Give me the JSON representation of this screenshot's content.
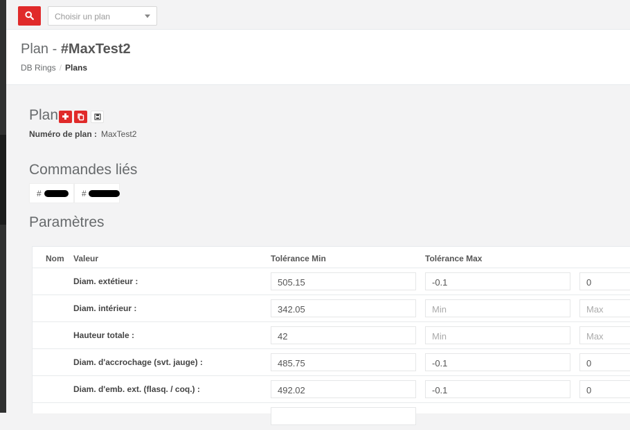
{
  "toolbar": {
    "select_placeholder": "Choisir un plan"
  },
  "header": {
    "title_prefix": "Plan - ",
    "title_id": "#MaxTest2",
    "breadcrumb": [
      "DB Rings",
      "Plans"
    ],
    "breadcrumb_sep": "/"
  },
  "plan_section": {
    "title": "Plan",
    "number_label": "Numéro de plan :",
    "number_value": "MaxTest2"
  },
  "orders_section": {
    "title": "Commandes liés",
    "items": [
      {
        "hash": "#",
        "redacted": true
      },
      {
        "hash": "#",
        "redacted": true
      }
    ]
  },
  "params_section": {
    "title": "Paramètres",
    "columns": [
      "Nom",
      "Valeur",
      "Tolérance Min",
      "Tolérance Max"
    ],
    "rows": [
      {
        "label": "Diam. extétieur :",
        "value": "505.15",
        "tol_min": "-0.1",
        "tol_max": "0"
      },
      {
        "label": "Diam. intérieur :",
        "value": "342.05",
        "tol_min": "",
        "tol_max": ""
      },
      {
        "label": "Hauteur totale :",
        "value": "42",
        "tol_min": "",
        "tol_max": ""
      },
      {
        "label": "Diam. d'accrochage (svt. jauge) :",
        "value": "485.75",
        "tol_min": "-0.1",
        "tol_max": "0"
      },
      {
        "label": "Diam. d'emb. ext. (flasq. / coq.) :",
        "value": "492.02",
        "tol_min": "-0.1",
        "tol_max": "0"
      }
    ],
    "placeholder_min": "Min",
    "placeholder_max": "Max"
  }
}
